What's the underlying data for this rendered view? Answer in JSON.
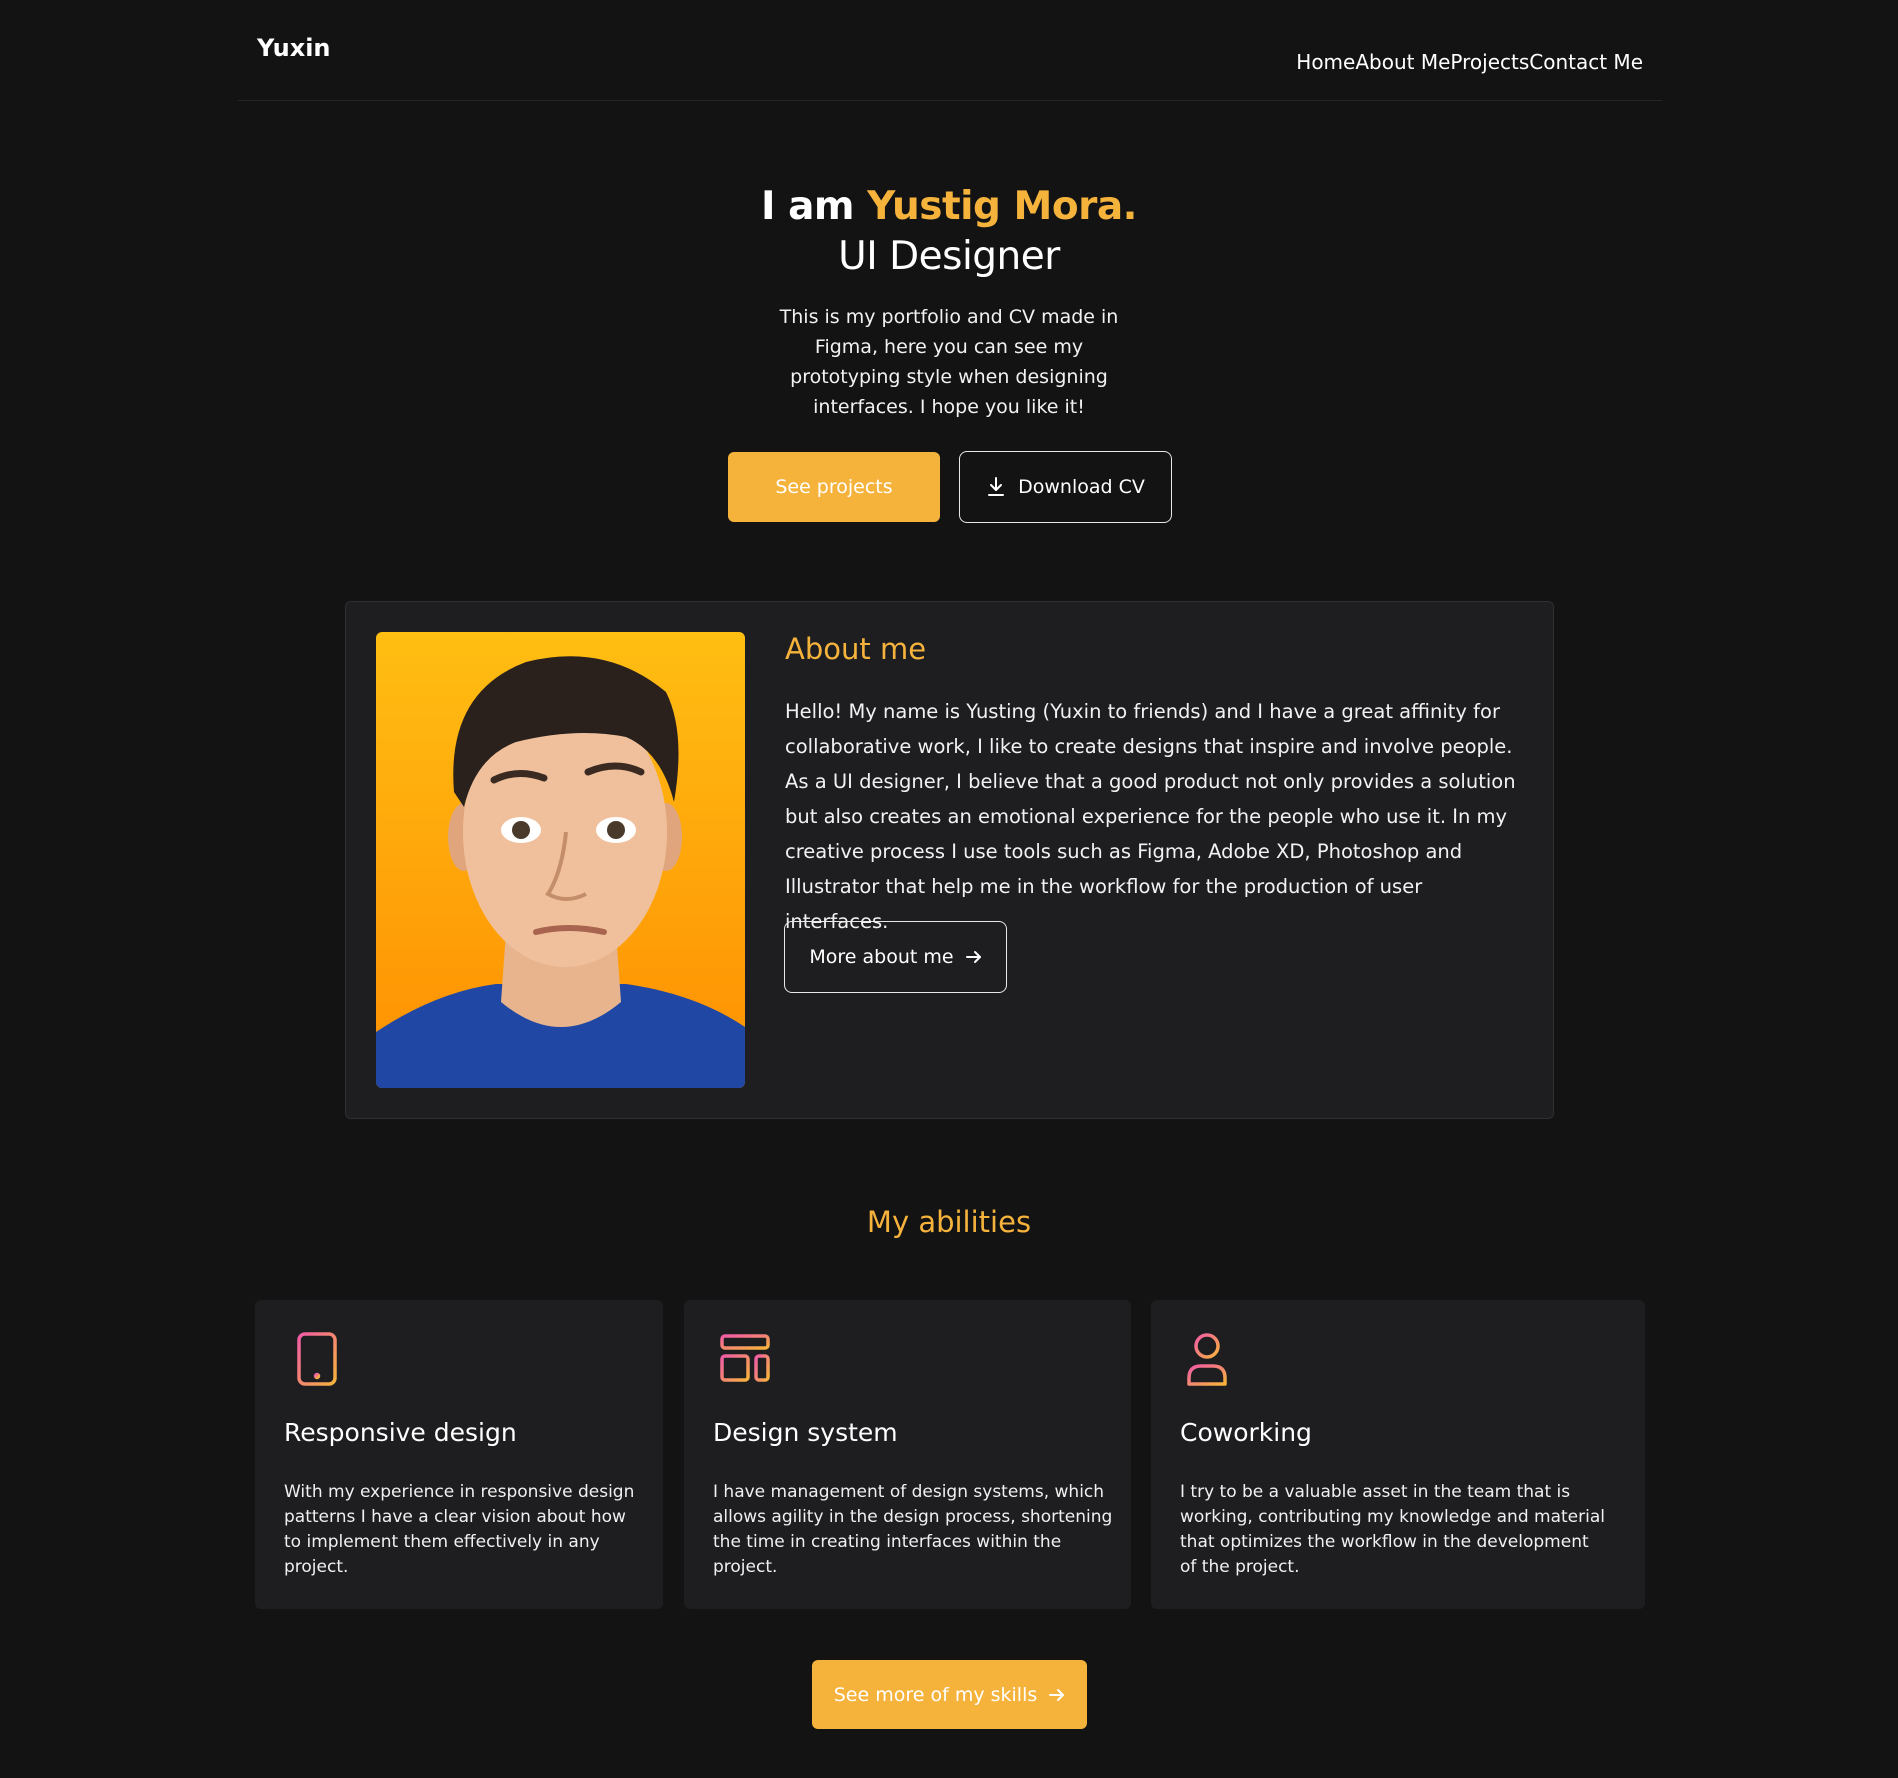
{
  "header": {
    "logo": "Yuxin",
    "nav": [
      "Home",
      "About Me",
      "Projects",
      "Contact Me"
    ]
  },
  "hero": {
    "intro": "I am ",
    "name": "Yustig Mora.",
    "role": "UI Designer",
    "description": "This is my portfolio and CV made in Figma, here you can see my prototyping style when designing interfaces. I hope you like it!",
    "primary_button": "See projects",
    "secondary_button": "Download CV",
    "secondary_icon": "download-icon"
  },
  "about": {
    "title": "About me",
    "text": "Hello! My name is Yusting (Yuxin to friends) and I have a great affinity for collaborative work, I like to create designs that inspire and involve people. As a UI designer, I believe that a good product not only provides a solution but also creates an emotional experience for the people who use it. In my creative process I use tools such as Figma, Adobe XD, Photoshop and Illustrator that help me in the workflow for the production of user interfaces.",
    "button": "More about me",
    "button_icon": "arrow-right-icon"
  },
  "abilities": {
    "title": "My abilities",
    "items": [
      {
        "icon": "tablet-icon",
        "title": "Responsive design",
        "text": "With my experience in responsive design patterns I have a clear vision about how to implement them effectively in any project."
      },
      {
        "icon": "layout-icon",
        "title": "Design system",
        "text": "I have management of design systems, which allows agility in the design process, shortening the time in creating interfaces within the project."
      },
      {
        "icon": "user-plus-icon",
        "title": "Coworking",
        "text": "I try to be a valuable asset in the team that is working, contributing my knowledge and material that optimizes the workflow in the development of the project."
      }
    ],
    "button": "See more of my skills",
    "button_icon": "arrow-right-icon"
  },
  "colors": {
    "background": "#131314",
    "surface": "#1e1e21",
    "accent": "#f6b33c",
    "icon_gradient_start": "#f25ba6",
    "icon_gradient_end": "#f6b33c"
  }
}
